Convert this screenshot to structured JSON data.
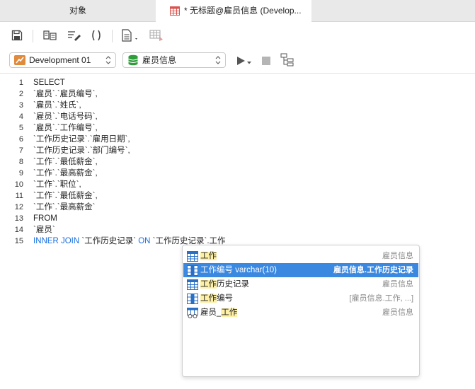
{
  "tabs": {
    "objects": "对象",
    "query": "* 无标题@雇员信息 (Develop..."
  },
  "toolbar": {
    "icons": [
      "save-icon",
      "beautify-icon",
      "sql-builder-icon",
      "code-snippet-icon",
      "text-document-icon",
      "explain-icon"
    ]
  },
  "connection": {
    "selected": "Development 01"
  },
  "database": {
    "selected": "雇员信息"
  },
  "editor": {
    "lines": [
      {
        "n": "1",
        "text": "SELECT",
        "kw": true
      },
      {
        "n": "2",
        "text": "`雇员`.`雇员编号`,",
        "kw": false
      },
      {
        "n": "3",
        "text": "`雇员`.`姓氏`,",
        "kw": false
      },
      {
        "n": "4",
        "text": "`雇员`.`电话号码`,",
        "kw": false
      },
      {
        "n": "5",
        "text": "`雇员`.`工作编号`,",
        "kw": false
      },
      {
        "n": "6",
        "text": "`工作历史记录`.`雇用日期`,",
        "kw": false
      },
      {
        "n": "7",
        "text": "`工作历史记录`.`部门编号`,",
        "kw": false
      },
      {
        "n": "8",
        "text": "`工作`.`最低薪金`,",
        "kw": false
      },
      {
        "n": "9",
        "text": "`工作`.`最高薪金`,",
        "kw": false
      },
      {
        "n": "10",
        "text": "`工作`.`职位`,",
        "kw": false
      },
      {
        "n": "11",
        "text": "`工作`.`最低薪金`,",
        "kw": false
      },
      {
        "n": "12",
        "text": "`工作`.`最高薪金`",
        "kw": false
      },
      {
        "n": "13",
        "text": "FROM",
        "kw": true
      },
      {
        "n": "14",
        "text": "`雇员`",
        "kw": false
      }
    ],
    "line15": {
      "n": "15",
      "kw1": "INNER JOIN",
      "part1": " `工作历史记录` ",
      "kw2": "ON",
      "part2": " `工作历史记录`.工作"
    }
  },
  "autocomplete": {
    "items": [
      {
        "pre": "",
        "match": "工作",
        "post": "",
        "desc": "雇员信息",
        "icon": "table-icon",
        "selected": false
      },
      {
        "pre": "",
        "match": "工作",
        "post": "编号 varchar(10)",
        "desc": "雇员信息.工作历史记录",
        "icon": "column-icon",
        "selected": true
      },
      {
        "pre": "",
        "match": "工作",
        "post": "历史记录",
        "desc": "雇员信息",
        "icon": "table-icon",
        "selected": false
      },
      {
        "pre": "",
        "match": "工作",
        "post": "编号",
        "desc": "[雇员信息.工作, ...]",
        "icon": "column-icon",
        "selected": false
      },
      {
        "pre": "雇员_",
        "match": "工作",
        "post": "",
        "desc": "雇员信息",
        "icon": "view-icon",
        "selected": false
      }
    ]
  }
}
